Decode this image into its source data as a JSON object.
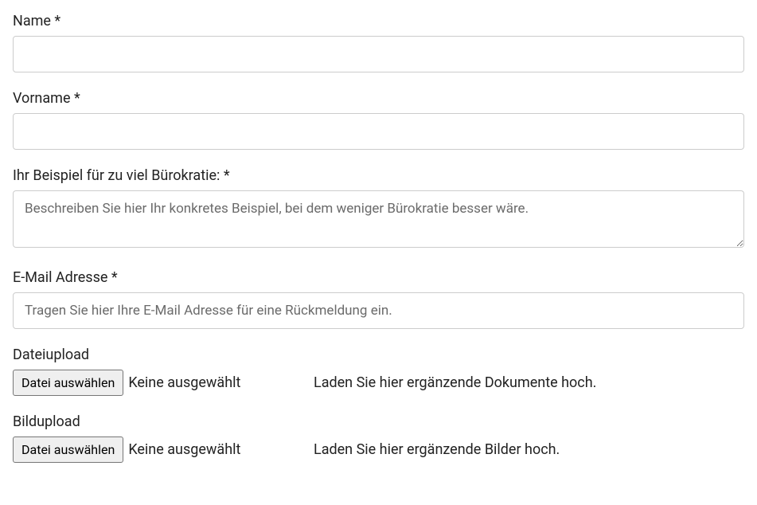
{
  "form": {
    "name": {
      "label": "Name *",
      "value": ""
    },
    "vorname": {
      "label": "Vorname *",
      "value": ""
    },
    "beispiel": {
      "label": "Ihr Beispiel für zu viel Bürokratie: *",
      "placeholder": "Beschreiben Sie hier Ihr konkretes Beispiel, bei dem weniger Bürokratie besser wäre.",
      "value": ""
    },
    "email": {
      "label": "E-Mail Adresse *",
      "placeholder": "Tragen Sie hier Ihre E-Mail Adresse für eine Rückmeldung ein.",
      "value": ""
    },
    "dateiupload": {
      "label": "Dateiupload",
      "button": "Datei auswählen",
      "status": "Keine ausgewählt",
      "hint": "Laden Sie hier ergänzende Dokumente hoch."
    },
    "bildupload": {
      "label": "Bildupload",
      "button": "Datei auswählen",
      "status": "Keine ausgewählt",
      "hint": "Laden Sie hier ergänzende Bilder hoch."
    }
  }
}
